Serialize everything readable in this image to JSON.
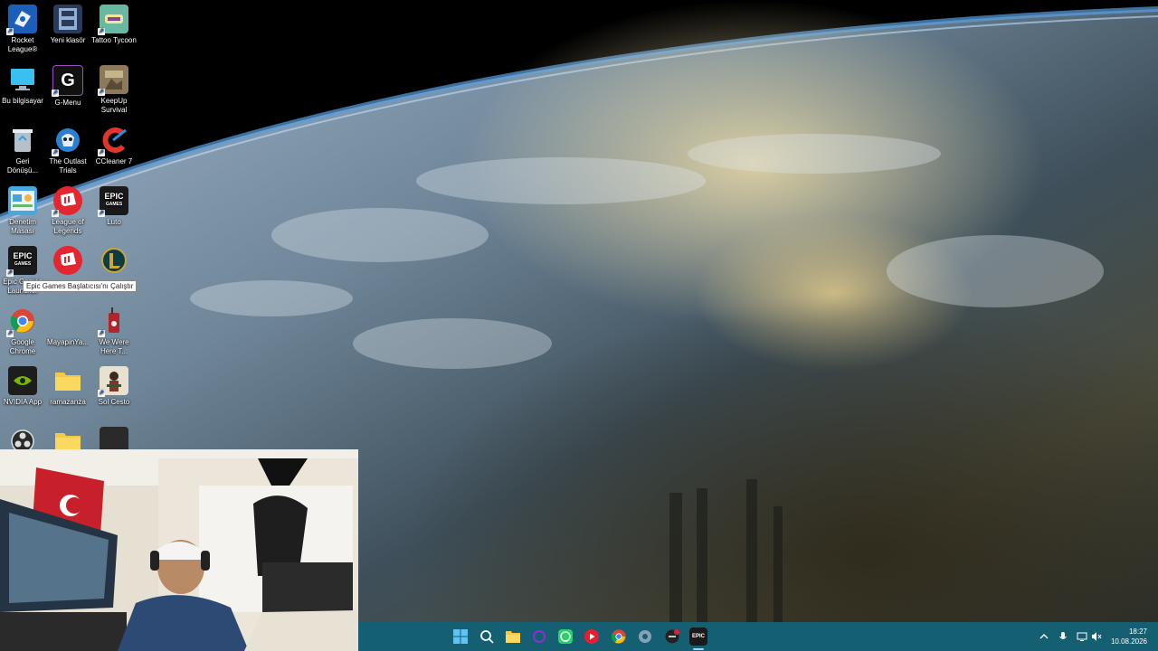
{
  "desktop": {
    "icons": [
      {
        "label": "Rocket League®",
        "icon": "rocket-league-icon"
      },
      {
        "label": "Yeni klasör",
        "icon": "video-folder-icon"
      },
      {
        "label": "Tattoo Tycoon",
        "icon": "tattoo-tycoon-icon"
      },
      {
        "label": "Bu bilgisayar",
        "icon": "computer-icon"
      },
      {
        "label": "G-Menu",
        "icon": "g-menu-icon"
      },
      {
        "label": "KeepUp Survival",
        "icon": "keepup-survival-icon"
      },
      {
        "label": "Geri Dönüşü...",
        "icon": "recycle-bin-icon"
      },
      {
        "label": "The Outlast Trials",
        "icon": "outlast-trials-icon"
      },
      {
        "label": "CCleaner 7",
        "icon": "ccleaner-icon"
      },
      {
        "label": "Denetim Masası",
        "icon": "control-panel-icon"
      },
      {
        "label": "League of Legends",
        "icon": "riot-client-icon"
      },
      {
        "label": "Luto",
        "icon": "epic-games-icon"
      },
      {
        "label": "Epic Games Launcher",
        "icon": "epic-games-icon"
      },
      {
        "label": "",
        "icon": "riot-client-icon"
      },
      {
        "label": "",
        "icon": "league-of-legends-icon"
      },
      {
        "label": "Google Chrome",
        "icon": "chrome-icon"
      },
      {
        "label": "MayapinYa...",
        "icon": "blank-icon"
      },
      {
        "label": "We Were Here T...",
        "icon": "walkie-talkie-icon"
      },
      {
        "label": "NVIDIA App",
        "icon": "nvidia-icon"
      },
      {
        "label": "ramazanza",
        "icon": "folder-icon"
      },
      {
        "label": "Sol Cesto",
        "icon": "sol-cesto-icon"
      },
      {
        "label": "",
        "icon": "obs-icon"
      },
      {
        "label": "",
        "icon": "folder-icon"
      },
      {
        "label": "",
        "icon": "dark-app-icon"
      }
    ],
    "tooltip": "Epic Games Başlatıcısı'nı Çalıştır",
    "epic_text": "EPIC",
    "epic_sub": "GAMES",
    "g_letter": "G"
  },
  "taskbar": {
    "apps": [
      "start-icon",
      "search-icon",
      "file-explorer-icon",
      "app-ring-icon",
      "whatsapp-icon",
      "youtube-music-icon",
      "chrome-icon",
      "settings-icon",
      "app-notify-icon",
      "epic-games-icon"
    ],
    "tray": [
      "chevron-up-icon",
      "microphone-icon",
      "display-icon",
      "speaker-muted-icon"
    ],
    "time": "18:27",
    "date": "10.08.2026"
  }
}
